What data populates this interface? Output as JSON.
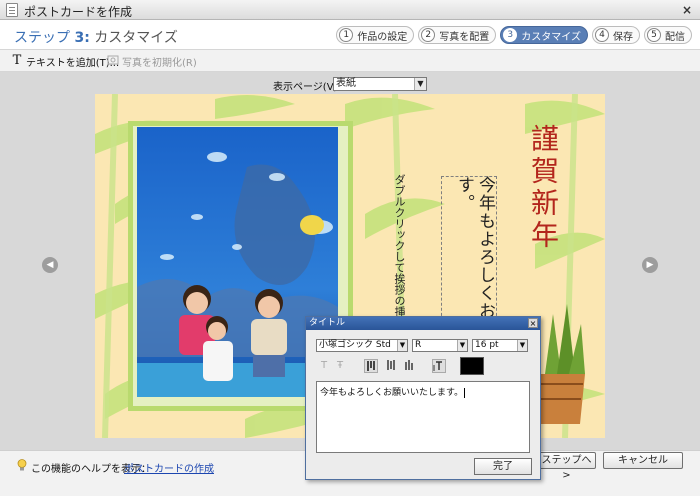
{
  "window": {
    "title": "ポストカードを作成",
    "close_glyph": "×"
  },
  "stepbar": {
    "prefix": "ステップ ",
    "current": "3:",
    "name": " カスタマイズ",
    "steps": [
      {
        "num": "1",
        "label": "作品の設定"
      },
      {
        "num": "2",
        "label": "写真を配置"
      },
      {
        "num": "3",
        "label": "カスタマイズ"
      },
      {
        "num": "4",
        "label": "保存"
      },
      {
        "num": "5",
        "label": "配信"
      }
    ]
  },
  "toolbar": {
    "add_text_label": "テキストを追加(T)...",
    "reset_photo_label": "写真を初期化(R)"
  },
  "workspace": {
    "page_label": "表示ページ(V):",
    "page_value": "表紙",
    "prev_glyph": "◀",
    "next_glyph": "▶"
  },
  "card": {
    "greeting": "謹賀新年",
    "message": "今年もよろしくお願いいたします。",
    "hint": "ダブルクリックして挨拶の挿入します"
  },
  "dialog": {
    "title": "タイトル",
    "close_glyph": "×",
    "font": "小塚ゴシック Std",
    "style": "R",
    "size": "16 pt",
    "text": "今年もよろしくお願いいたします。",
    "done_label": "完了",
    "color": "#000000"
  },
  "footer": {
    "help_label": "この機能のヘルプを表示：",
    "help_link": "ポストカードの作成",
    "next_label": "ステップへ >",
    "cancel_label": "キャンセル"
  },
  "colors": {
    "accent": "#5a7fb6",
    "card_background": "#fbe7b3",
    "bamboo": "#b9da6e",
    "greeting_red": "#b3261c"
  }
}
